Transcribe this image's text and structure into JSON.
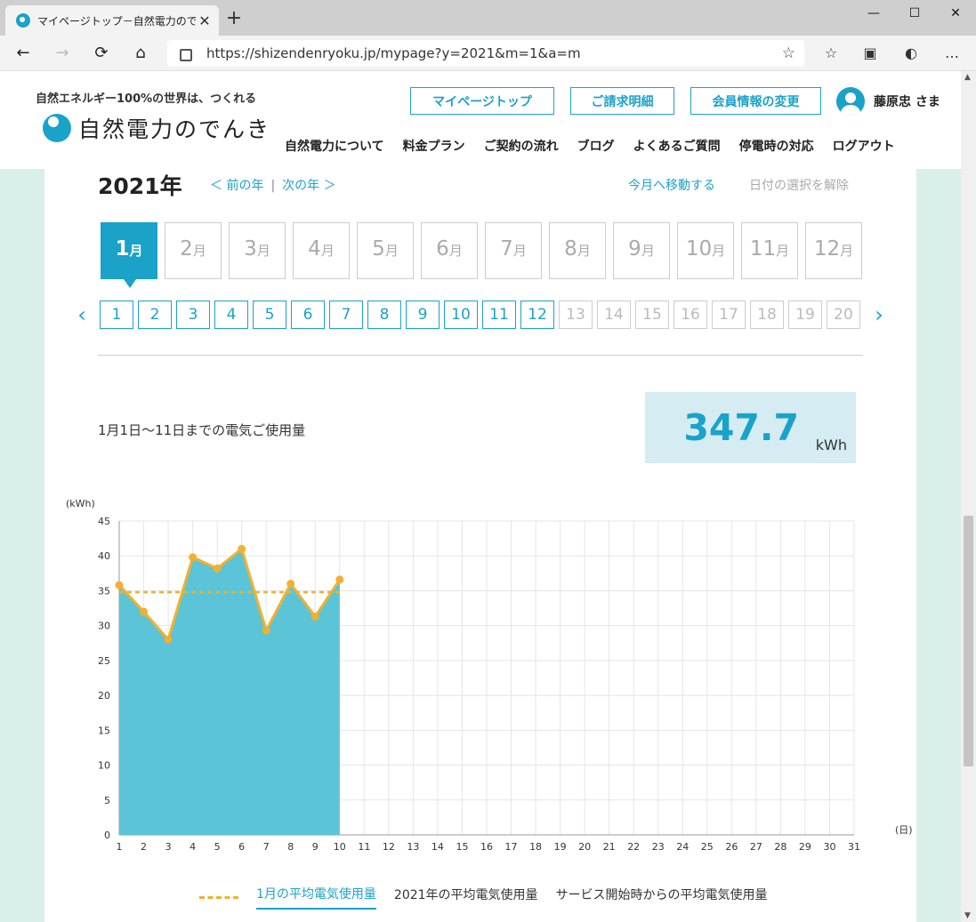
{
  "browser": {
    "tab_title": "マイページトップ－自然電力のでんき",
    "tab_close": "✕",
    "new_tab": "+",
    "url": "https://shizendenryoku.jp/mypage?y=2021&m=1&a=m",
    "controls": {
      "minimize": "—",
      "maximize": "☐",
      "close": "✕"
    },
    "nav": {
      "back": "←",
      "forward": "→",
      "reload": "⟳",
      "home": "⌂"
    },
    "tools": {
      "favorites": "☆",
      "reading": "≡",
      "collections": "▣",
      "profile": "◐",
      "more": "…"
    },
    "star": "☆"
  },
  "header": {
    "tagline": "自然エネルギー100%の世界は、つくれる",
    "logo_text": "自然電力のでんき",
    "buttons": [
      "マイページトップ",
      "ご請求明細",
      "会員情報の変更"
    ],
    "user_name": "藤原忠 さま",
    "nav": [
      "自然電力について",
      "料金プラン",
      "ご契約の流れ",
      "ブログ",
      "よくあるご質問",
      "停電時の対応",
      "ログアウト"
    ]
  },
  "selector": {
    "year": "2021年",
    "prev_year": "＜ 前の年",
    "separator": "|",
    "next_year": "次の年 ＞",
    "today": "今月へ移動する",
    "clear": "日付の選択を解除",
    "month_unit": "月",
    "months": [
      "1",
      "2",
      "3",
      "4",
      "5",
      "6",
      "7",
      "8",
      "9",
      "10",
      "11",
      "12"
    ],
    "active_month": 1,
    "day_prev": "‹",
    "day_next": "›",
    "days": [
      "1",
      "2",
      "3",
      "4",
      "5",
      "6",
      "7",
      "8",
      "9",
      "10",
      "11",
      "12",
      "13",
      "14",
      "15",
      "16",
      "17",
      "18",
      "19",
      "20"
    ],
    "enabled_days": 12
  },
  "usage": {
    "label": "1月1日～11日までの電気ご使用量",
    "value": "347.7",
    "unit": "kWh"
  },
  "chart_data": {
    "type": "area",
    "ylabel": "(kWh)",
    "xlabel": "(日)",
    "ylim": [
      0,
      45
    ],
    "yticks": [
      0,
      5,
      10,
      15,
      20,
      25,
      30,
      35,
      40,
      45
    ],
    "xlim": [
      1,
      31
    ],
    "x": [
      1,
      2,
      3,
      4,
      5,
      6,
      7,
      8,
      9,
      10
    ],
    "series": [
      {
        "values": [
          35.8,
          32.0,
          28.0,
          39.8,
          38.2,
          41.0,
          29.3,
          36.0,
          31.3,
          36.6
        ]
      },
      {
        "name": "1月の平均電気使用量",
        "values": [
          34.8,
          34.8,
          34.8,
          34.8,
          34.8,
          34.8,
          34.8,
          34.8,
          34.8,
          34.8
        ]
      }
    ],
    "grid": true,
    "colors": {
      "area": "#5bc4d6",
      "line": "#f0b12f",
      "avg": "#f0b12f",
      "grid": "#e5e5e5"
    }
  },
  "legend": {
    "items": [
      "1月の平均電気使用量",
      "2021年の平均電気使用量",
      "サービス開始時からの平均電気使用量"
    ],
    "active": 0
  }
}
